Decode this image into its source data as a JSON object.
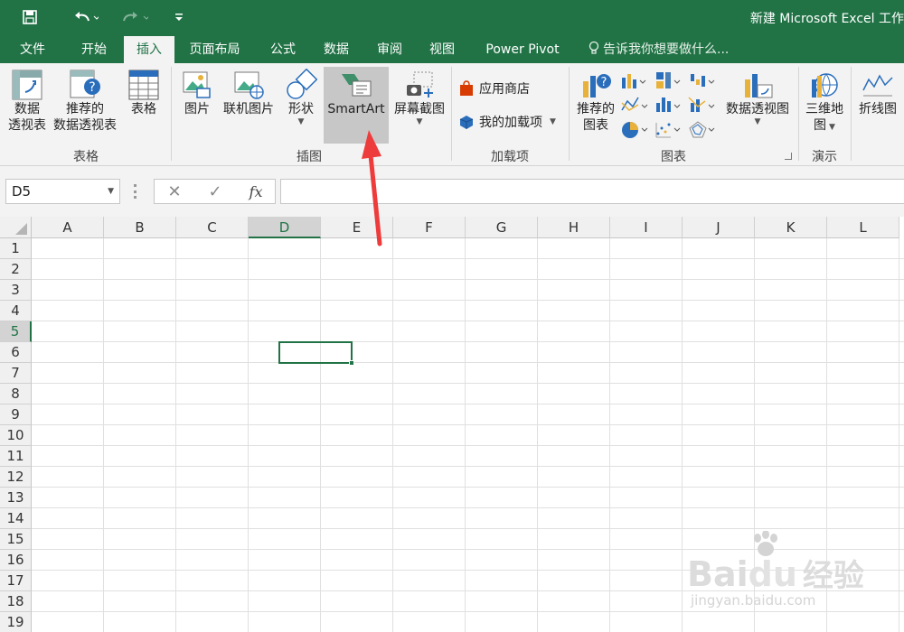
{
  "app": {
    "title": "新建 Microsoft Excel 工作",
    "accent": "#217346",
    "highlight": "#c7c7c7",
    "arrow_color": "#ee3b3b"
  },
  "quick_access": [
    {
      "name": "save-icon"
    },
    {
      "name": "undo-icon"
    },
    {
      "name": "redo-icon"
    },
    {
      "name": "customize-icon"
    }
  ],
  "tabs": [
    {
      "label": "文件"
    },
    {
      "label": "开始"
    },
    {
      "label": "插入",
      "active": true
    },
    {
      "label": "页面布局"
    },
    {
      "label": "公式"
    },
    {
      "label": "数据"
    },
    {
      "label": "审阅"
    },
    {
      "label": "视图"
    },
    {
      "label": "Power Pivot"
    }
  ],
  "tell_me": "告诉我你想要做什么...",
  "ribbon": {
    "groups": {
      "tables": "表格",
      "illustrations": "插图",
      "addins": "加载项",
      "charts": "图表",
      "tours": "演示"
    },
    "buttons": {
      "pivot_line1": "数据",
      "pivot_line2": "透视表",
      "recpivot_line1": "推荐的",
      "recpivot_line2": "数据透视表",
      "table": "表格",
      "pictures": "图片",
      "online_pictures": "联机图片",
      "shapes": "形状",
      "smartart": "SmartArt",
      "screenshot": "屏幕截图",
      "store": "应用商店",
      "my_addins": "我的加载项",
      "rec_charts_line1": "推荐的",
      "rec_charts_line2": "图表",
      "pivot_chart": "数据透视图",
      "map3d_line1": "三维地",
      "map3d_line2": "图",
      "line_sparkline": "折线图"
    }
  },
  "formula_bar": {
    "name_box": "D5",
    "fx": "fx",
    "cancel": "✕",
    "enter": "✓",
    "formula": ""
  },
  "grid": {
    "columns": [
      "A",
      "B",
      "C",
      "D",
      "E",
      "F",
      "G",
      "H",
      "I",
      "J",
      "K",
      "L"
    ],
    "rows": [
      "1",
      "2",
      "3",
      "4",
      "5",
      "6",
      "7",
      "8",
      "9",
      "10",
      "11",
      "12",
      "13",
      "14",
      "15",
      "16",
      "17",
      "18",
      "19"
    ],
    "active_column": "D",
    "active_row": "5"
  },
  "watermark": {
    "brand": "Bai",
    "brand2": "du",
    "cn": "经验",
    "url": "jingyan.baidu.com"
  }
}
